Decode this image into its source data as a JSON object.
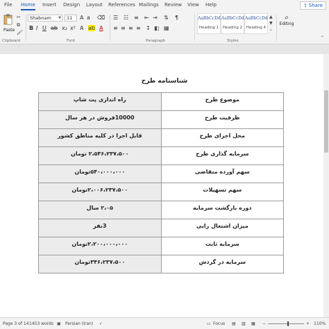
{
  "ribbon_tabs": [
    "File",
    "Home",
    "Insert",
    "Design",
    "Layout",
    "References",
    "Mailings",
    "Review",
    "View",
    "Help"
  ],
  "share_label": "Share",
  "clipboard": {
    "paste_label": "Paste",
    "group_label": "Clipboard"
  },
  "font": {
    "name": "Shabnam",
    "size": "11",
    "group_label": "Font"
  },
  "paragraph": {
    "group_label": "Paragraph"
  },
  "styles": {
    "group_label": "Styles",
    "items": [
      {
        "sample": "AaBbCcDd",
        "name": "Heading 1"
      },
      {
        "sample": "AaBbCcDd",
        "name": "Heading 2"
      },
      {
        "sample": "AaBbCcDd",
        "name": "Heading 4"
      }
    ]
  },
  "editing_label": "Editing",
  "document": {
    "title": "شناسنامه طرح",
    "rows": [
      {
        "label": "موضوع طرح",
        "value": "راه اندازی پت شاپ"
      },
      {
        "label": "ظرفیت طرح",
        "value": "10000فروش در هر سال"
      },
      {
        "label": "محل اجرای طرح",
        "value": "قابل اجرا در کلیه مناطق کشور"
      },
      {
        "label": "سرمایه گذاری طرح",
        "value": "۲،۵۴۶،۲۳۷،۵۰۰ تومان"
      },
      {
        "label": "سهم آورده متقاضی",
        "value": "۵۴۰،۰۰۰،۰۰۰تومان"
      },
      {
        "label": "سهم تسهیلات",
        "value": "۲،۰۰۶،۲۳۷،۵۰۰تومان"
      },
      {
        "label": "دوره بازگشت سرمایه",
        "value": "۲،۰۵ سال"
      },
      {
        "label": "میزان اشتغال زایی",
        "value": "3نفر"
      },
      {
        "label": "سرمایه ثابت",
        "value": "۲،۲۰۰،۰۰۰،۰۰۰تومان"
      },
      {
        "label": "سرمایه در گردش",
        "value": "۳۴۶،۲۳۷،۵۰۰تومان"
      }
    ]
  },
  "status": {
    "page": "Page 3 of 14",
    "words": "1453 words",
    "language": "Persian (Iran)",
    "focus": "Focus",
    "zoom": "110%"
  }
}
